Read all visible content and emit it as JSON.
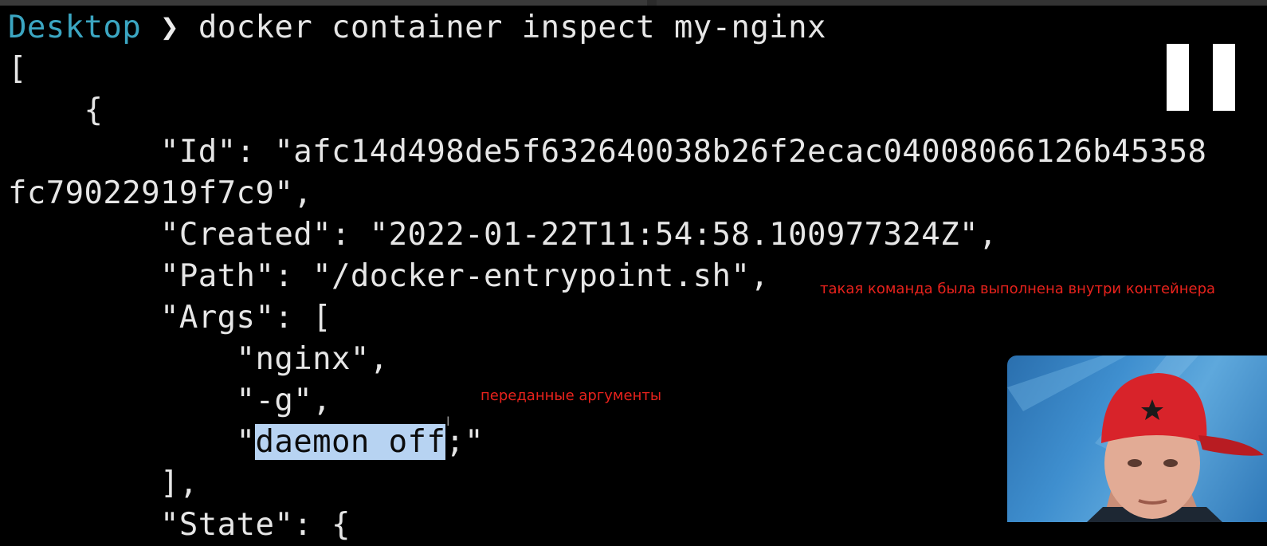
{
  "terminal": {
    "prompt_dir": "Desktop",
    "prompt_arrow": "❯",
    "command": " docker container inspect my-nginx",
    "lines": {
      "open_bracket": "[",
      "open_brace": "    {",
      "id": "        \"Id\": \"afc14d498de5f632640038b26f2ecac04008066126b45358",
      "id_cont": "fc79022919f7c9\",",
      "created": "        \"Created\": \"2022-01-22T11:54:58.100977324Z\",",
      "path": "        \"Path\": \"/docker-entrypoint.sh\",",
      "args": "        \"Args\": [",
      "arg_nginx": "            \"nginx\",",
      "arg_g": "            \"-g\",",
      "arg_daemon_pre": "            \"",
      "arg_daemon_selected": "daemon off",
      "arg_daemon_post": ";\"",
      "args_close": "        ],",
      "state": "        \"State\": {"
    }
  },
  "annotations": {
    "path_note": "такая команда была выполнена внутри контейнера",
    "args_note": "переданные аргументы",
    "color": "#e8221c"
  },
  "overlay": {
    "pause_icon": "pause-icon",
    "cursor_icon": "text-cursor-icon",
    "webcam": "presenter-webcam"
  },
  "colors": {
    "background": "#000000",
    "text": "#e6e6e6",
    "prompt_dir": "#3ba6c2",
    "selection": "#b7d3f2"
  }
}
